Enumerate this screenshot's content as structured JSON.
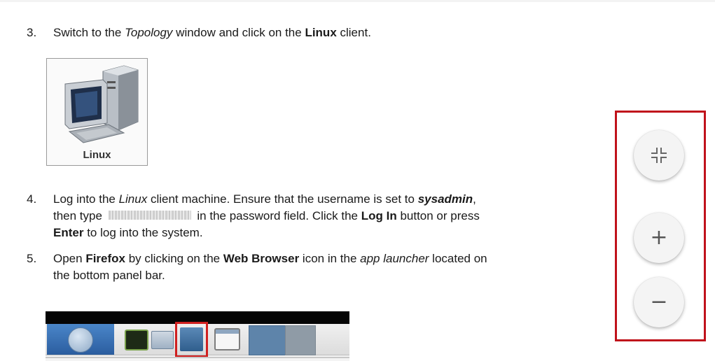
{
  "steps": [
    {
      "number": "3.",
      "text_parts": [
        "Switch to the ",
        "Topology",
        " window and click on the ",
        "Linux",
        " client."
      ]
    },
    {
      "number": "4.",
      "line1": [
        "Log into the ",
        "Linux",
        " client machine.  Ensure that the username is set to ",
        "sysadmin",
        ","
      ],
      "line2": [
        "then type ",
        " in the password field.  Click the ",
        "Log In",
        " button or press"
      ],
      "line3": [
        "Enter",
        " to log into the system."
      ]
    },
    {
      "number": "5.",
      "line1": [
        "Open ",
        "Firefox",
        " by clicking on the ",
        "Web Browser",
        " icon in the ",
        "app launcher",
        " located on"
      ],
      "line2": "the bottom panel bar."
    }
  ],
  "linux_icon": {
    "label": "Linux"
  },
  "zoom_controls": {
    "fit_icon": "fullscreen-exit-icon",
    "zoom_in_symbol": "+",
    "zoom_out_symbol": "−"
  },
  "colors": {
    "highlight_red": "#c0121b"
  }
}
